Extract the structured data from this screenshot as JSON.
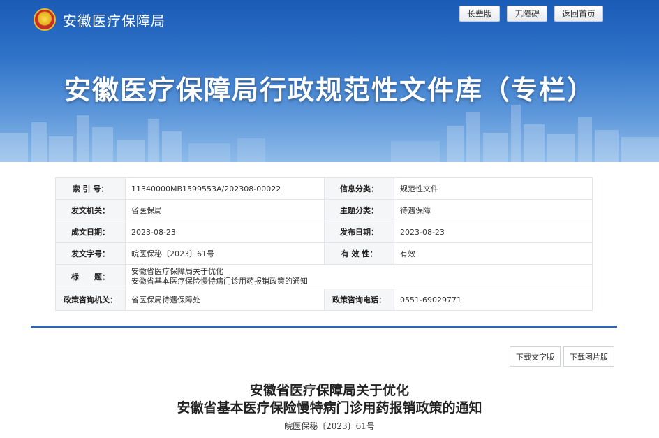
{
  "header": {
    "site_name": "安徽医疗保障局",
    "buttons": [
      "长辈版",
      "无障碍",
      "返回首页"
    ],
    "banner_title": "安徽医疗保障局行政规范性文件库（专栏）"
  },
  "info": {
    "index_no_label": "索 引 号：",
    "index_no": "11340000MB1599553A/202308-00022",
    "category_label": "信息分类：",
    "category": "规范性文件",
    "issuer_label": "发文机关：",
    "issuer": "省医保局",
    "topic_label": "主题分类：",
    "topic": "待遇保障",
    "created_label": "成文日期：",
    "created": "2023-08-23",
    "published_label": "发布日期：",
    "published": "2023-08-23",
    "doc_no_label": "发文字号：",
    "doc_no": "皖医保秘〔2023〕61号",
    "validity_label": "有 效 性：",
    "validity": "有效",
    "title_label": "标　　题：",
    "title_line1": "安徽省医疗保障局关于优化",
    "title_line2": "安徽省基本医疗保险慢特病门诊用药报销政策的通知",
    "consult_org_label": "政策咨询机关：",
    "consult_org": "省医保局待遇保障处",
    "consult_phone_label": "政策咨询电话：",
    "consult_phone": "0551-69029771"
  },
  "downloads": {
    "text_version": "下载文字版",
    "image_version": "下载图片版"
  },
  "document": {
    "title_line1": "安徽省医疗保障局关于优化",
    "title_line2": "安徽省基本医疗保险慢特病门诊用药报销政策的通知",
    "doc_number": "皖医保秘〔2023〕61号"
  },
  "colors": {
    "banner_top": "#1a5bb6",
    "banner_bottom": "#8ebbe9",
    "divider": "#2f66b3"
  }
}
